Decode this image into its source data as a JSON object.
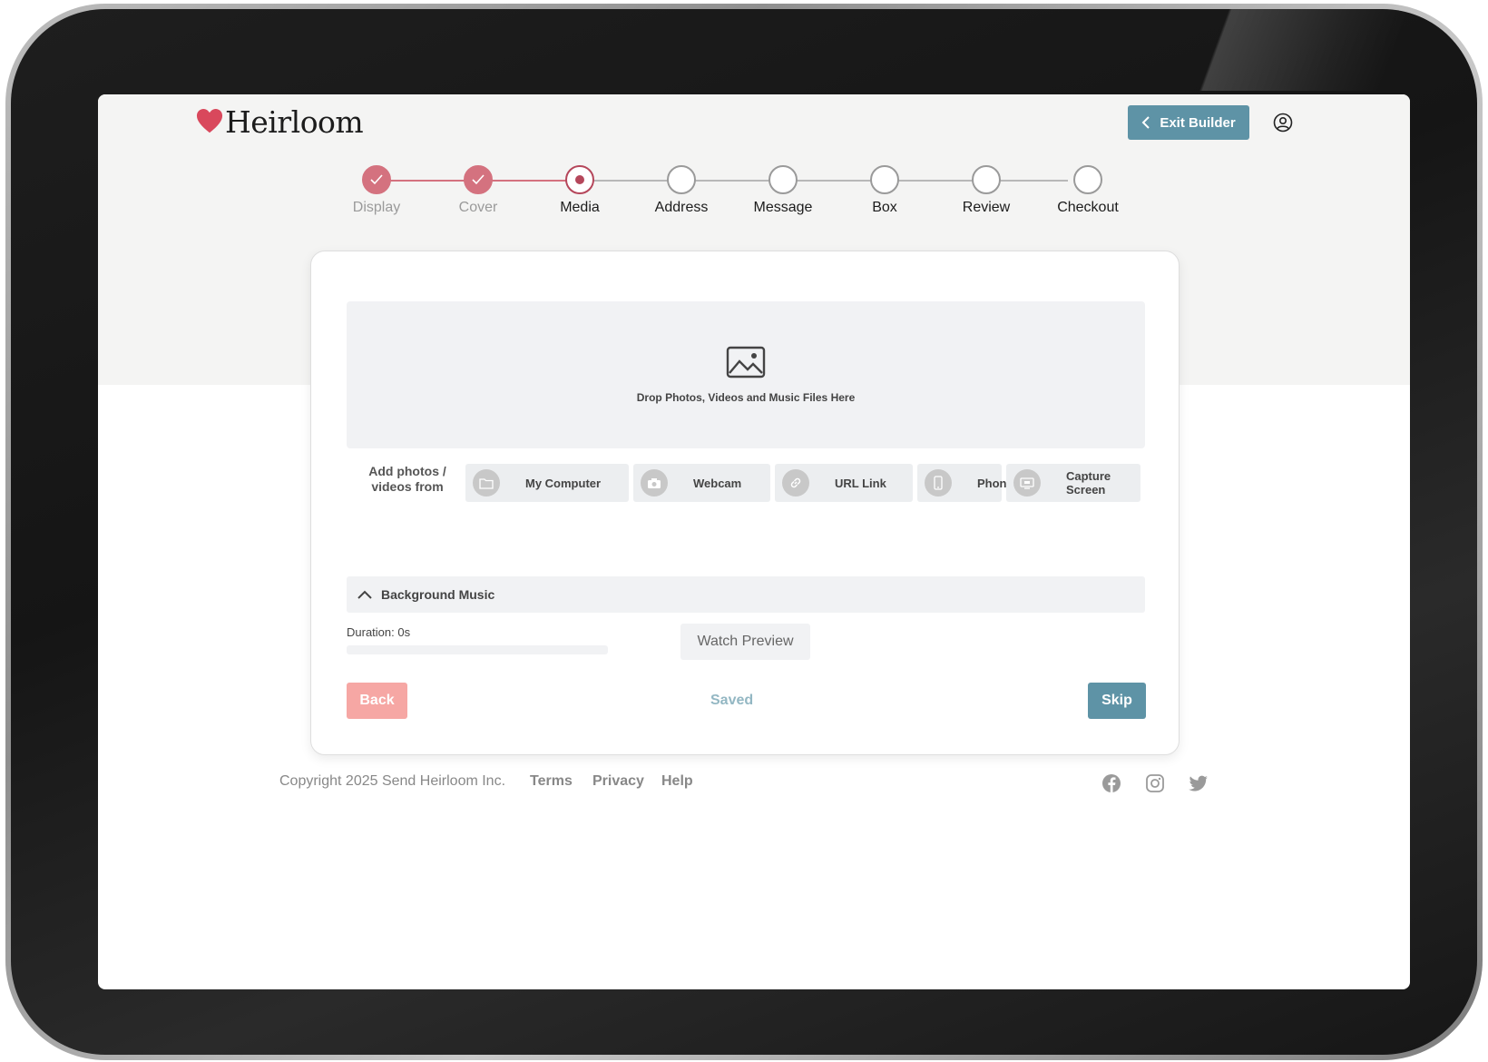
{
  "brand": {
    "name": "Heirloom",
    "accent": "#d9485c"
  },
  "header": {
    "exit_label": "Exit Builder",
    "exit_color": "#5e93a6"
  },
  "stepper": {
    "steps": [
      {
        "label": "Display",
        "state": "done"
      },
      {
        "label": "Cover",
        "state": "done"
      },
      {
        "label": "Media",
        "state": "active"
      },
      {
        "label": "Address",
        "state": "todo"
      },
      {
        "label": "Message",
        "state": "todo"
      },
      {
        "label": "Box",
        "state": "todo"
      },
      {
        "label": "Review",
        "state": "todo"
      },
      {
        "label": "Checkout",
        "state": "todo"
      }
    ]
  },
  "upload": {
    "dropzone_text": "Drop Photos, Videos and Music Files Here",
    "sources_label": "Add photos / videos from",
    "sources": [
      {
        "label": "My Computer",
        "icon": "folder-icon"
      },
      {
        "label": "Webcam",
        "icon": "camera-icon"
      },
      {
        "label": "URL Link",
        "icon": "link-icon"
      },
      {
        "label": "Phone",
        "icon": "phone-icon"
      },
      {
        "label": "Capture Screen",
        "icon": "screen-icon"
      }
    ]
  },
  "music": {
    "label": "Background Music",
    "duration": "Duration: 0s",
    "preview_label": "Watch Preview"
  },
  "actions": {
    "back": "Back",
    "saved": "Saved",
    "skip": "Skip"
  },
  "footer": {
    "copyright": "Copyright 2025 Send Heirloom Inc.",
    "links": [
      "Terms",
      "Privacy",
      "Help"
    ],
    "social": [
      "facebook-icon",
      "instagram-icon",
      "twitter-icon"
    ]
  }
}
